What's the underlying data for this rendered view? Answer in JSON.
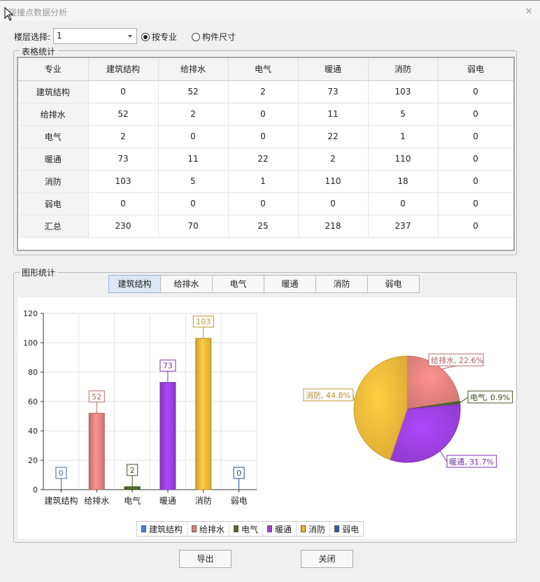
{
  "window": {
    "title": "碰撞点数据分析",
    "close_glyph": "×"
  },
  "floor": {
    "label": "楼层选择:",
    "value": "1"
  },
  "mode": {
    "option_major": "按专业",
    "option_size": "构件尺寸",
    "selected": "major"
  },
  "table_group": {
    "title": "表格统计"
  },
  "table": {
    "headers": [
      "专业",
      "建筑结构",
      "给排水",
      "电气",
      "暖通",
      "消防",
      "弱电"
    ],
    "rows": [
      [
        "建筑结构",
        "0",
        "52",
        "2",
        "73",
        "103",
        "0"
      ],
      [
        "给排水",
        "52",
        "2",
        "0",
        "11",
        "5",
        "0"
      ],
      [
        "电气",
        "2",
        "0",
        "0",
        "22",
        "1",
        "0"
      ],
      [
        "暖通",
        "73",
        "11",
        "22",
        "2",
        "110",
        "0"
      ],
      [
        "消防",
        "103",
        "5",
        "1",
        "110",
        "18",
        "0"
      ],
      [
        "弱电",
        "0",
        "0",
        "0",
        "0",
        "0",
        "0"
      ],
      [
        "汇总",
        "230",
        "70",
        "25",
        "218",
        "237",
        "0"
      ]
    ]
  },
  "chart_group": {
    "title": "图形统计"
  },
  "tabs": [
    "建筑结构",
    "给排水",
    "电气",
    "暖通",
    "消防",
    "弱电"
  ],
  "active_tab": 0,
  "colors": {
    "建筑结构": "#4f81d8",
    "给排水": "#e2827e",
    "电气": "#4f6b2a",
    "暖通": "#9b3fe0",
    "消防": "#f0b93a",
    "弱电": "#2f55b8"
  },
  "chart_data": [
    {
      "type": "bar",
      "categories": [
        "建筑结构",
        "给排水",
        "电气",
        "暖通",
        "消防",
        "弱电"
      ],
      "values": [
        0,
        52,
        2,
        73,
        103,
        0
      ],
      "data_labels": [
        "0",
        "52",
        "2",
        "73",
        "103",
        "0"
      ],
      "ylim": [
        0,
        120
      ],
      "yticks": [
        "0",
        "20",
        "40",
        "60",
        "80",
        "100",
        "120"
      ],
      "grid": true
    },
    {
      "type": "pie",
      "categories": [
        "给排水",
        "电气",
        "暖通",
        "消防"
      ],
      "values": [
        22.6,
        0.9,
        31.7,
        44.8
      ],
      "labels": [
        "给排水, 22.6%",
        "电气, 0.9%",
        "暖通, 31.7%",
        "消防, 44.8%"
      ]
    }
  ],
  "legend": [
    "建筑结构",
    "给排水",
    "电气",
    "暖通",
    "消防",
    "弱电"
  ],
  "buttons": {
    "export": "导出",
    "close": "关闭"
  }
}
